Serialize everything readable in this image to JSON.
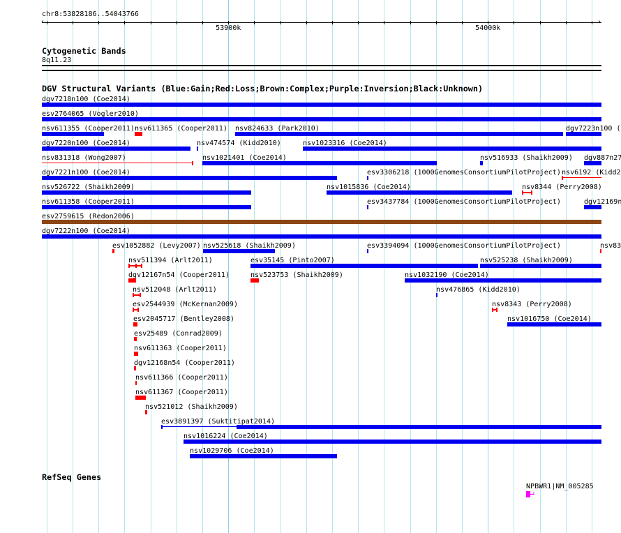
{
  "view": {
    "region_label": "chr8:53828186..54043766",
    "start_kb": 53828.186,
    "end_kb": 54043.766
  },
  "ruler": {
    "major_ticks": [
      {
        "kb": 53900,
        "label": "53900k"
      },
      {
        "kb": 54000,
        "label": "54000k"
      }
    ],
    "minor_step_kb": 10
  },
  "cytoband": {
    "title": "Cytogenetic Bands",
    "band": "8q11.23"
  },
  "dgv": {
    "title": "DGV Structural Variants (Blue:Gain;Red:Loss;Brown:Complex;Purple:Inversion;Black:Unknown)",
    "colors": {
      "gain": "#0000ee",
      "loss": "#ff0000",
      "complex": "#8b4513"
    },
    "rows": [
      [
        {
          "label": "dgv7218n100 (Coe2014)",
          "s": 53828.2,
          "e": 54043.8,
          "type": "gain",
          "style": "block"
        }
      ],
      [
        {
          "label": "esv2764065 (Vogler2010)",
          "s": 53828.2,
          "e": 54043.8,
          "type": "gain",
          "style": "block"
        }
      ],
      [
        {
          "label": "nsv611355 (Cooper2011)",
          "s": 53828.2,
          "e": 53852.2,
          "type": "gain",
          "style": "block"
        },
        {
          "label": "nsv611365 (Cooper2011)",
          "s": 53864.0,
          "e": 53866.9,
          "type": "loss",
          "style": "block"
        },
        {
          "label": "nsv824633 (Park2010)",
          "s": 53902.7,
          "e": 54029.0,
          "type": "gain",
          "style": "block"
        },
        {
          "label": "dgv7223n100 (",
          "s": 54030.1,
          "e": 54043.8,
          "type": "gain",
          "style": "block"
        }
      ],
      [
        {
          "label": "dgv7220n100 (Coe2014)",
          "s": 53828.2,
          "e": 53885.5,
          "type": "gain",
          "style": "block"
        },
        {
          "label": "nsv474574 (Kidd2010)",
          "s": 53887.9,
          "e": 53888.4,
          "type": "gain",
          "style": "block"
        },
        {
          "label": "nsv1023316 (Coe2014)",
          "s": 53928.8,
          "e": 54043.8,
          "type": "gain",
          "style": "block"
        }
      ],
      [
        {
          "label": "nsv831318 (Wong2007)",
          "s": 53828.2,
          "e": 53886.6,
          "type": "loss",
          "style": "line-end"
        },
        {
          "label": "nsv1021401 (Coe2014)",
          "s": 53890.1,
          "e": 53980.4,
          "type": "gain",
          "style": "block"
        },
        {
          "label": "nsv516933 (Shaikh2009)",
          "s": 53997.0,
          "e": 53998.1,
          "type": "gain",
          "style": "block"
        },
        {
          "label": "dgv887n27",
          "s": 54037.1,
          "e": 54043.8,
          "type": "gain",
          "style": "block"
        }
      ],
      [
        {
          "label": "dgv7221n100 (Coe2014)",
          "s": 53828.2,
          "e": 53941.9,
          "type": "gain",
          "style": "block"
        },
        {
          "label": "esv3306218 (1000GenomesConsortiumPilotProject)",
          "s": 53953.5,
          "e": 53954.0,
          "type": "gain",
          "style": "block"
        },
        {
          "label": "nsv6192 (Kidd20",
          "s": 54028.5,
          "e": 54043.8,
          "type": "loss",
          "style": "line-start"
        }
      ],
      [
        {
          "label": "nsv526722 (Shaikh2009)",
          "s": 53828.2,
          "e": 53908.9,
          "type": "gain",
          "style": "block"
        },
        {
          "label": "nsv1015836 (Coe2014)",
          "s": 53937.9,
          "e": 54009.4,
          "type": "gain",
          "style": "block"
        },
        {
          "label": "nsv8344 (Perry2008)",
          "s": 54013.2,
          "e": 54017.2,
          "type": "loss",
          "style": "ends"
        }
      ],
      [
        {
          "label": "nsv611358 (Cooper2011)",
          "s": 53828.2,
          "e": 53908.9,
          "type": "gain",
          "style": "block"
        },
        {
          "label": "esv3437784 (1000GenomesConsortiumPilotProject)",
          "s": 53953.5,
          "e": 53954.0,
          "type": "gain",
          "style": "block"
        },
        {
          "label": "dgv12169n",
          "s": 54037.1,
          "e": 54043.8,
          "type": "gain",
          "style": "block"
        }
      ],
      [
        {
          "label": "esv2759615 (Redon2006)",
          "s": 53828.2,
          "e": 54043.8,
          "type": "complex",
          "style": "block"
        }
      ],
      [
        {
          "label": "dgv7222n100 (Coe2014)",
          "s": 53828.2,
          "e": 54043.8,
          "type": "gain",
          "style": "block"
        }
      ],
      [
        {
          "label": "esv1052882 (Levy2007)",
          "s": 53855.4,
          "e": 53856.2,
          "type": "loss",
          "style": "block"
        },
        {
          "label": "nsv525618 (Shaikh2009)",
          "s": 53890.3,
          "e": 53918.0,
          "type": "gain",
          "style": "block"
        },
        {
          "label": "esv3394094 (1000GenomesConsortiumPilotProject)",
          "s": 53953.5,
          "e": 53954.0,
          "type": "gain",
          "style": "block"
        },
        {
          "label": "nsv83",
          "s": 54043.3,
          "e": 54043.8,
          "type": "loss",
          "style": "block"
        }
      ],
      [
        {
          "label": "nsv511394 (Arlt2011)",
          "s": 53861.6,
          "e": 53866.9,
          "type": "loss",
          "style": "ends-mid"
        },
        {
          "label": "esv35145 (Pinto2007)",
          "s": 53908.6,
          "e": 53996.2,
          "type": "gain",
          "style": "block"
        },
        {
          "label": "nsv525238 (Shaikh2009)",
          "s": 53997.0,
          "e": 54043.8,
          "type": "gain",
          "style": "block"
        }
      ],
      [
        {
          "label": "dgv12167n54 (Cooper2011)",
          "s": 53861.6,
          "e": 53864.5,
          "type": "loss",
          "style": "block"
        },
        {
          "label": "nsv523753 (Shaikh2009)",
          "s": 53908.6,
          "e": 53911.8,
          "type": "loss",
          "style": "block"
        },
        {
          "label": "nsv1032190 (Coe2014)",
          "s": 53968.0,
          "e": 54043.8,
          "type": "gain",
          "style": "block"
        }
      ],
      [
        {
          "label": "nsv512048 (Arlt2011)",
          "s": 53863.2,
          "e": 53866.4,
          "type": "loss",
          "style": "ends"
        },
        {
          "label": "nsv476865 (Kidd2010)",
          "s": 53980.1,
          "e": 53980.6,
          "type": "gain",
          "style": "block"
        }
      ],
      [
        {
          "label": "esv2544939 (McKernan2009)",
          "s": 53863.2,
          "e": 53865.6,
          "type": "loss",
          "style": "ends"
        },
        {
          "label": "nsv8343 (Perry2008)",
          "s": 54001.6,
          "e": 54003.8,
          "type": "loss",
          "style": "ends"
        }
      ],
      [
        {
          "label": "esv2045717 (Bentley2008)",
          "s": 53863.4,
          "e": 53865.1,
          "type": "loss",
          "style": "block"
        },
        {
          "label": "nsv1016750 (Coe2014)",
          "s": 54007.5,
          "e": 54043.8,
          "type": "gain",
          "style": "block"
        }
      ],
      [
        {
          "label": "esv25489 (Conrad2009)",
          "s": 53863.7,
          "e": 53864.8,
          "type": "loss",
          "style": "block"
        }
      ],
      [
        {
          "label": "nsv611363 (Cooper2011)",
          "s": 53863.7,
          "e": 53865.3,
          "type": "loss",
          "style": "block"
        }
      ],
      [
        {
          "label": "dgv12168n54 (Cooper2011)",
          "s": 53863.7,
          "e": 53864.5,
          "type": "loss",
          "style": "block"
        }
      ],
      [
        {
          "label": "nsv611366 (Cooper2011)",
          "s": 53864.2,
          "e": 53864.8,
          "type": "loss",
          "style": "block"
        }
      ],
      [
        {
          "label": "nsv611367 (Cooper2011)",
          "s": 53864.2,
          "e": 53868.3,
          "type": "loss",
          "style": "block"
        }
      ],
      [
        {
          "label": "nsv521012 (Shaikh2009)",
          "s": 53868.0,
          "e": 53868.8,
          "type": "loss",
          "style": "block"
        }
      ],
      [
        {
          "label": "esv3891397 (Suktitipat2014)",
          "s": 53874.2,
          "e": 54043.8,
          "thick_start": 53903.2,
          "type": "gain",
          "style": "split"
        }
      ],
      [
        {
          "label": "nsv1016224 (Coe2014)",
          "s": 53882.8,
          "e": 54043.8,
          "type": "gain",
          "style": "block"
        }
      ],
      [
        {
          "label": "nsv1029706 (Coe2014)",
          "s": 53885.2,
          "e": 53941.9,
          "type": "gain",
          "style": "block"
        }
      ]
    ]
  },
  "refseq": {
    "title": "RefSeq Genes",
    "color": "#ff00ff",
    "genes": [
      {
        "label": "NPBWR1|NM_005285",
        "s": 54014.8,
        "e": 54018.0,
        "strand": "+"
      }
    ]
  }
}
